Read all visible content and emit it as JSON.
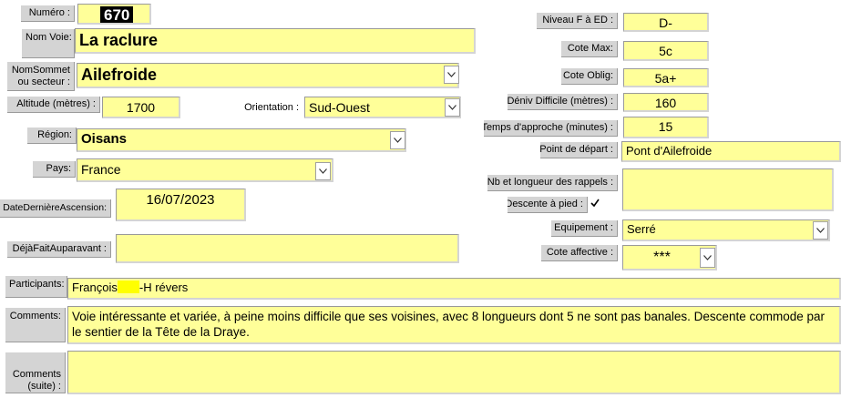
{
  "left": {
    "numero": {
      "label": "Numéro :",
      "value": "670"
    },
    "nom_voie": {
      "label": "Nom Voie:",
      "value": "La raclure"
    },
    "nom_sommet": {
      "label_line1": "NomSommet",
      "label_line2": "ou secteur :",
      "value": "Ailefroide"
    },
    "altitude": {
      "label": "Altitude (mètres) :",
      "value": "1700"
    },
    "orientation": {
      "label": "Orientation :",
      "value": "Sud-Ouest"
    },
    "region": {
      "label": "Région:",
      "value": "Oisans"
    },
    "pays": {
      "label": "Pays:",
      "value": "France"
    },
    "date_derniere": {
      "label": "DateDernièreAscension:",
      "value": "16/07/2023"
    },
    "deja_fait": {
      "label": "DéjàFaitAuparavant :",
      "value": ""
    }
  },
  "right": {
    "niveau": {
      "label": "Niveau F à ED :",
      "value": "D-"
    },
    "cote_max": {
      "label": "Cote Max:",
      "value": "5c"
    },
    "cote_oblig": {
      "label": "Cote Oblig:",
      "value": "5a+"
    },
    "deniv": {
      "label": "Déniv Difficile (mètres) :",
      "value": "160"
    },
    "approche": {
      "label": "Temps d'approche (minutes) :",
      "value": "15"
    },
    "depart": {
      "label": "Point de départ :",
      "value": "Pont d'Ailefroide"
    },
    "rappels": {
      "label": "Nb et longueur des rappels :",
      "value": ""
    },
    "descente": {
      "label": "Descente à pied :",
      "checked": true
    },
    "equipement": {
      "label": "Equipement :",
      "value": "Serré"
    },
    "cote_affective": {
      "label": "Cote affective :",
      "value": "***"
    }
  },
  "bottom": {
    "participants": {
      "label": "Participants:",
      "value_before": "François",
      "value_after": "-H révers"
    },
    "comments": {
      "label": "Comments:",
      "value": "Voie intéressante et variée, à peine moins difficile que ses voisines, avec 8 longueurs dont 5 ne sont pas banales. Descente commode par le sentier de la Tête de la Draye."
    },
    "comments_suite": {
      "label_line1": "Comments",
      "label_line2": "(suite) :",
      "value": ""
    }
  },
  "colors": {
    "field_bg": "#ffff99",
    "label_bg": "#d4d4d4",
    "mask": "#ffff00"
  }
}
